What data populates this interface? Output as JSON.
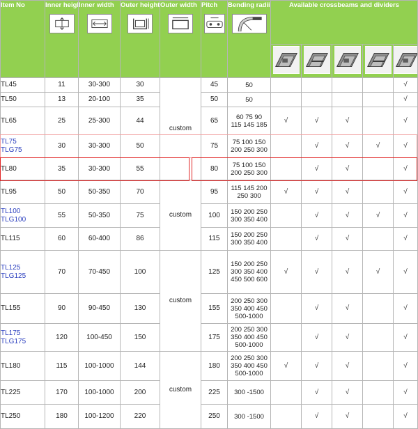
{
  "headers": {
    "item_no": "Item No",
    "inner_height": "Inner height",
    "inner_width": "Inner width",
    "outer_height": "Outer height",
    "outer_width": "Outer width",
    "pitch": "Pitch",
    "bending_radii": "Bending radii",
    "crossbeams": "Available crossbeams and dividers"
  },
  "check": "√",
  "custom": "custom",
  "rows": [
    {
      "item": [
        "TL45"
      ],
      "blue": false,
      "ih": "11",
      "iw": "30-300",
      "oh": "30",
      "pitch": "45",
      "radii": [
        "50"
      ],
      "checks": [
        false,
        false,
        false,
        false,
        true
      ]
    },
    {
      "item": [
        "TL50"
      ],
      "blue": false,
      "ih": "13",
      "iw": "20-100",
      "oh": "35",
      "pitch": "50",
      "radii": [
        "50"
      ],
      "checks": [
        false,
        false,
        false,
        false,
        true
      ]
    },
    {
      "item": [
        "TL65"
      ],
      "blue": false,
      "ih": "25",
      "iw": "25-300",
      "oh": "44",
      "pitch": "65",
      "radii": [
        "60 75 90",
        "115 145 185"
      ],
      "checks": [
        true,
        true,
        true,
        false,
        true
      ]
    },
    {
      "item": [
        "TL75",
        "TLG75"
      ],
      "blue": true,
      "ih": "30",
      "iw": "30-300",
      "oh": "50",
      "pitch": "75",
      "radii": [
        "75 100 150",
        "200 250 300"
      ],
      "checks": [
        false,
        true,
        true,
        true,
        true
      ]
    },
    {
      "item": [
        "TL80"
      ],
      "blue": false,
      "ih": "35",
      "iw": "30-300",
      "oh": "55",
      "pitch": "80",
      "radii": [
        "75 100 150",
        "200 250 300"
      ],
      "checks": [
        false,
        true,
        true,
        false,
        true
      ]
    },
    {
      "item": [
        "TL95"
      ],
      "blue": false,
      "ih": "50",
      "iw": "50-350",
      "oh": "70",
      "pitch": "95",
      "radii": [
        "115 145 200",
        "250 300"
      ],
      "checks": [
        true,
        true,
        true,
        false,
        true
      ]
    },
    {
      "item": [
        "TL100",
        "TLG100"
      ],
      "blue": true,
      "ih": "55",
      "iw": "50-350",
      "oh": "75",
      "pitch": "100",
      "radii": [
        "150 200 250",
        "300 350 400"
      ],
      "checks": [
        false,
        true,
        true,
        true,
        true
      ]
    },
    {
      "item": [
        "TL115"
      ],
      "blue": false,
      "ih": "60",
      "iw": "60-400",
      "oh": "86",
      "pitch": "115",
      "radii": [
        "150 200 250",
        "300 350 400"
      ],
      "checks": [
        false,
        true,
        true,
        false,
        true
      ]
    },
    {
      "item": [
        "TL125",
        "TLG125"
      ],
      "blue": true,
      "ih": "70",
      "iw": "70-450",
      "oh": "100",
      "pitch": "125",
      "radii": [
        "150 200 250",
        "300 350 400",
        "450 500 600"
      ],
      "checks": [
        true,
        true,
        true,
        true,
        true
      ]
    },
    {
      "item": [
        "TL155"
      ],
      "blue": false,
      "ih": "90",
      "iw": "90-450",
      "oh": "130",
      "pitch": "155",
      "radii": [
        "200 250 300",
        "350 400 450",
        "500-1000"
      ],
      "checks": [
        false,
        true,
        true,
        false,
        true
      ]
    },
    {
      "item": [
        "TL175",
        "TLG175"
      ],
      "blue": true,
      "ih": "120",
      "iw": "100-450",
      "oh": "150",
      "pitch": "175",
      "radii": [
        "200 250 300",
        "350 400 450",
        "500-1000"
      ],
      "checks": [
        false,
        true,
        true,
        false,
        true
      ]
    },
    {
      "item": [
        "TL180"
      ],
      "blue": false,
      "ih": "115",
      "iw": "100-1000",
      "oh": "144",
      "pitch": "180",
      "radii": [
        "200 250 300",
        "350 400 450",
        "500-1000"
      ],
      "checks": [
        true,
        true,
        true,
        false,
        true
      ]
    },
    {
      "item": [
        "TL225"
      ],
      "blue": false,
      "ih": "170",
      "iw": "100-1000",
      "oh": "200",
      "pitch": "225",
      "radii": [
        "300 -1500"
      ],
      "checks": [
        false,
        true,
        true,
        false,
        true
      ]
    },
    {
      "item": [
        "TL250"
      ],
      "blue": false,
      "ih": "180",
      "iw": "100-1200",
      "oh": "220",
      "pitch": "250",
      "radii": [
        "300 -1500"
      ],
      "checks": [
        false,
        true,
        true,
        false,
        true
      ]
    }
  ]
}
